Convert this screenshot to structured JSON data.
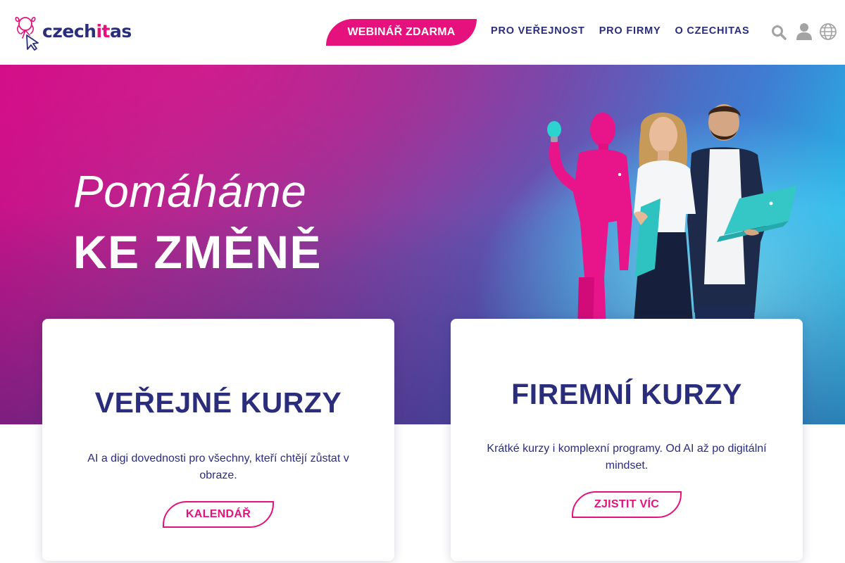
{
  "header": {
    "logo": {
      "text_main": "czech",
      "text_accent": "it",
      "text_end": "as",
      "icon": "czechitas-girl-cursor-logo-icon"
    },
    "cta_label": "WEBINÁŘ ZDARMA",
    "nav": [
      {
        "label": "PRO VEŘEJNOST"
      },
      {
        "label": "PRO FIRMY"
      },
      {
        "label": "O CZECHITAS"
      }
    ],
    "icons": [
      "search-icon",
      "user-icon",
      "globe-icon"
    ]
  },
  "hero": {
    "subtitle": "Pomáháme",
    "title": "KE ZMĚNĚ",
    "image": "hero-people-image"
  },
  "cards": [
    {
      "title": "VEŘEJNÉ KURZY",
      "description": "AI a digi dovednosti pro všechny, kteří chtějí zůstat v obraze.",
      "button_label": "KALENDÁŘ"
    },
    {
      "title": "FIREMNÍ KURZY",
      "description": "Krátké kurzy i komplexní programy. Od AI až po digitální mindset.",
      "button_label": "ZJISTIT VÍC"
    }
  ],
  "colors": {
    "brand_navy": "#2a2d7c",
    "brand_pink": "#e5127d",
    "hero_cyan": "#16d3ee",
    "white": "#ffffff"
  }
}
